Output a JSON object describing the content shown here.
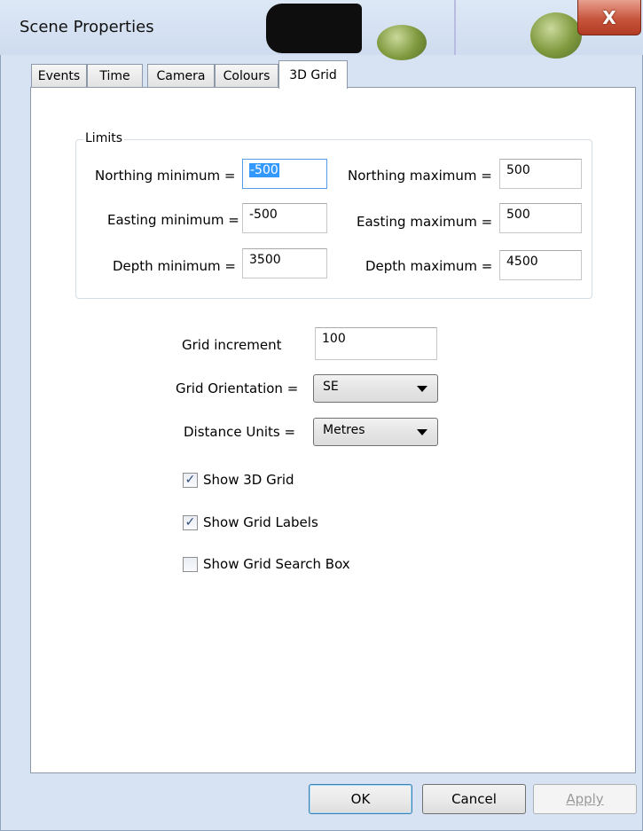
{
  "window": {
    "title": "Scene Properties",
    "close_glyph": "X"
  },
  "tabs": [
    {
      "label": "Events",
      "active": false
    },
    {
      "label": "Time",
      "active": false
    },
    {
      "label": "Camera",
      "active": false
    },
    {
      "label": "Colours",
      "active": false
    },
    {
      "label": "3D Grid",
      "active": true
    }
  ],
  "limits": {
    "group_title": "Limits",
    "northing_min_label": "Northing minimum =",
    "northing_min_value": "-500",
    "northing_max_label": "Northing maximum =",
    "northing_max_value": "500",
    "easting_min_label": "Easting minimum =",
    "easting_min_value": "-500",
    "easting_max_label": "Easting maximum =",
    "easting_max_value": "500",
    "depth_min_label": "Depth minimum =",
    "depth_min_value": "3500",
    "depth_max_label": "Depth maximum =",
    "depth_max_value": "4500"
  },
  "grid": {
    "increment_label": "Grid increment",
    "increment_value": "100",
    "orientation_label": "Grid Orientation =",
    "orientation_value": "SE",
    "units_label": "Distance Units =",
    "units_value": "Metres"
  },
  "checkboxes": [
    {
      "label": "Show 3D Grid",
      "checked": true
    },
    {
      "label": "Show Grid Labels",
      "checked": true
    },
    {
      "label": "Show Grid Search Box",
      "checked": false
    }
  ],
  "buttons": {
    "ok": "OK",
    "cancel": "Cancel",
    "apply": "Apply"
  }
}
